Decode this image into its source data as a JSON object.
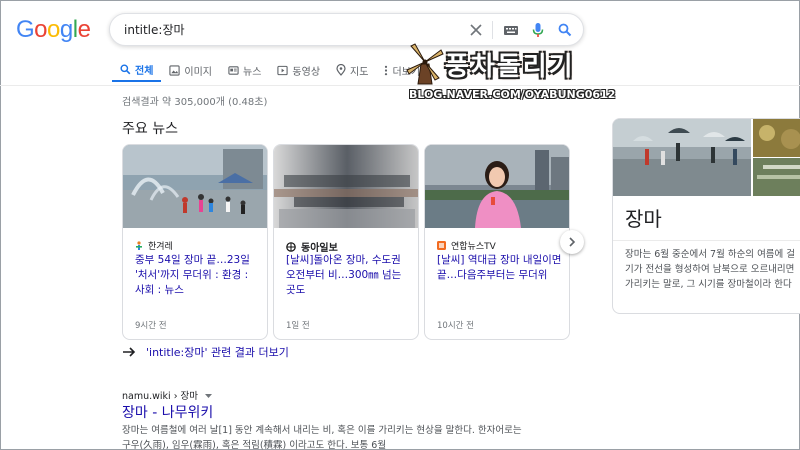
{
  "search": {
    "query": "intitle:장마"
  },
  "logo": {
    "letters": [
      {
        "char": "G",
        "color": "#4285f4"
      },
      {
        "char": "o",
        "color": "#ea4335"
      },
      {
        "char": "o",
        "color": "#fbbc05"
      },
      {
        "char": "g",
        "color": "#4285f4"
      },
      {
        "char": "l",
        "color": "#34a853"
      },
      {
        "char": "e",
        "color": "#ea4335"
      }
    ]
  },
  "tabs": [
    {
      "label": "전체",
      "icon": "search-icon",
      "active": true
    },
    {
      "label": "이미지",
      "icon": "image-icon",
      "active": false
    },
    {
      "label": "뉴스",
      "icon": "news-icon",
      "active": false
    },
    {
      "label": "동영상",
      "icon": "video-icon",
      "active": false
    },
    {
      "label": "지도",
      "icon": "map-pin-icon",
      "active": false
    },
    {
      "label": "더보기",
      "icon": "more-vert-icon",
      "active": false
    }
  ],
  "watermark": {
    "title": "풍차돌리기",
    "subtitle": "BLOG.NAVER.COM/OYABUNG0612"
  },
  "result_stats": "검색결과 약 305,000개 (0.48초)",
  "top_news": {
    "title": "주요 뉴스",
    "cards": [
      {
        "source": "한겨레",
        "headline": "중부 54일 장마 끝…23일 '처서'까지 무더위 : 환경 : 사회 : 뉴스",
        "time": "9시간 전"
      },
      {
        "source": "동아일보",
        "headline": "[날씨]돌아온 장마, 수도권 오전부터 비…300㎜ 넘는 곳도",
        "time": "1일 전"
      },
      {
        "source": "연합뉴스TV",
        "headline": "[날씨] 역대급 장마 내일이면 끝…다음주부터는 무더위",
        "time": "10시간 전"
      }
    ],
    "more_link": "'intitle:장마' 관련 결과 더보기"
  },
  "organic_result": {
    "breadcrumb": "namu.wiki › 장마",
    "title": "장마 - 나무위키",
    "snippet_line1": "장마는 여름철에 여러 날[1] 동안 계속해서 내리는 비, 혹은 이를 가리키는 현상을 말한다. 한자어로는",
    "snippet_line2": "구우(久雨), 임우(霖雨), 혹은 적림(積霖) 이라고도 한다. 보통 6월"
  },
  "knowledge_panel": {
    "title": "장마",
    "desc_line1": "장마는 6월 중순에서 7월 하순의 여름에 걸",
    "desc_line2": "기가 전선을 형성하여 남북으로 오르내리면",
    "desc_line3": "가리키는 말로, 그 시기를 장마철이라 한다"
  },
  "colors": {
    "link": "#1a0dab",
    "accent": "#1a73e8",
    "muted": "#70757a"
  }
}
